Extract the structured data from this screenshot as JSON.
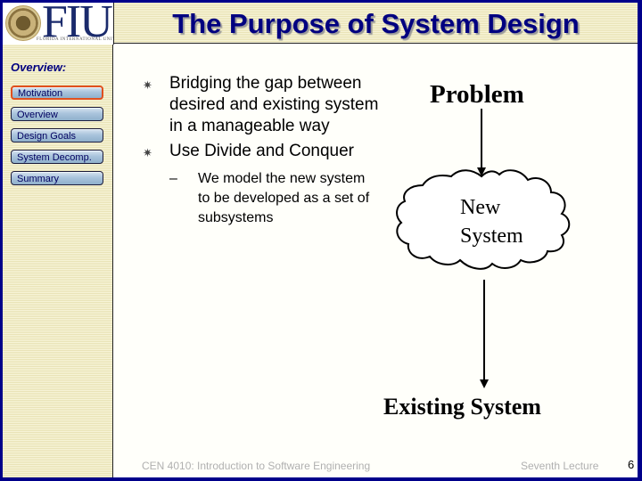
{
  "header": {
    "logo_text": "FIU",
    "logo_subtitle": "Florida International University",
    "title": "The Purpose of System Design"
  },
  "sidebar": {
    "title": "Overview:",
    "items": [
      {
        "label": "Motivation",
        "active": true
      },
      {
        "label": "Overview",
        "active": false
      },
      {
        "label": "Design Goals",
        "active": false
      },
      {
        "label": "System Decomp.",
        "active": false
      },
      {
        "label": "Summary",
        "active": false
      }
    ]
  },
  "content": {
    "bullet_icon": "asterisk-bullet-icon",
    "bullets": [
      {
        "text": "Bridging  the gap between desired and existing system in a manageable way"
      },
      {
        "text": "Use Divide and Conquer"
      }
    ],
    "sub_bullets": [
      {
        "marker": "–",
        "text": "We model the new system  to be developed as a set of subsystems"
      }
    ]
  },
  "diagram": {
    "problem_label": "Problem",
    "cloud_label_line1": "New",
    "cloud_label_line2": "System",
    "existing_label": "Existing System"
  },
  "footer": {
    "course": "CEN 4010: Introduction to Software Engineering",
    "lecture": "Seventh Lecture",
    "page_number": "6"
  },
  "colors": {
    "frame": "#00008a",
    "title": "#000080",
    "active_nav_border": "#e0501e",
    "sidebar_background": "#f4f0cc"
  }
}
